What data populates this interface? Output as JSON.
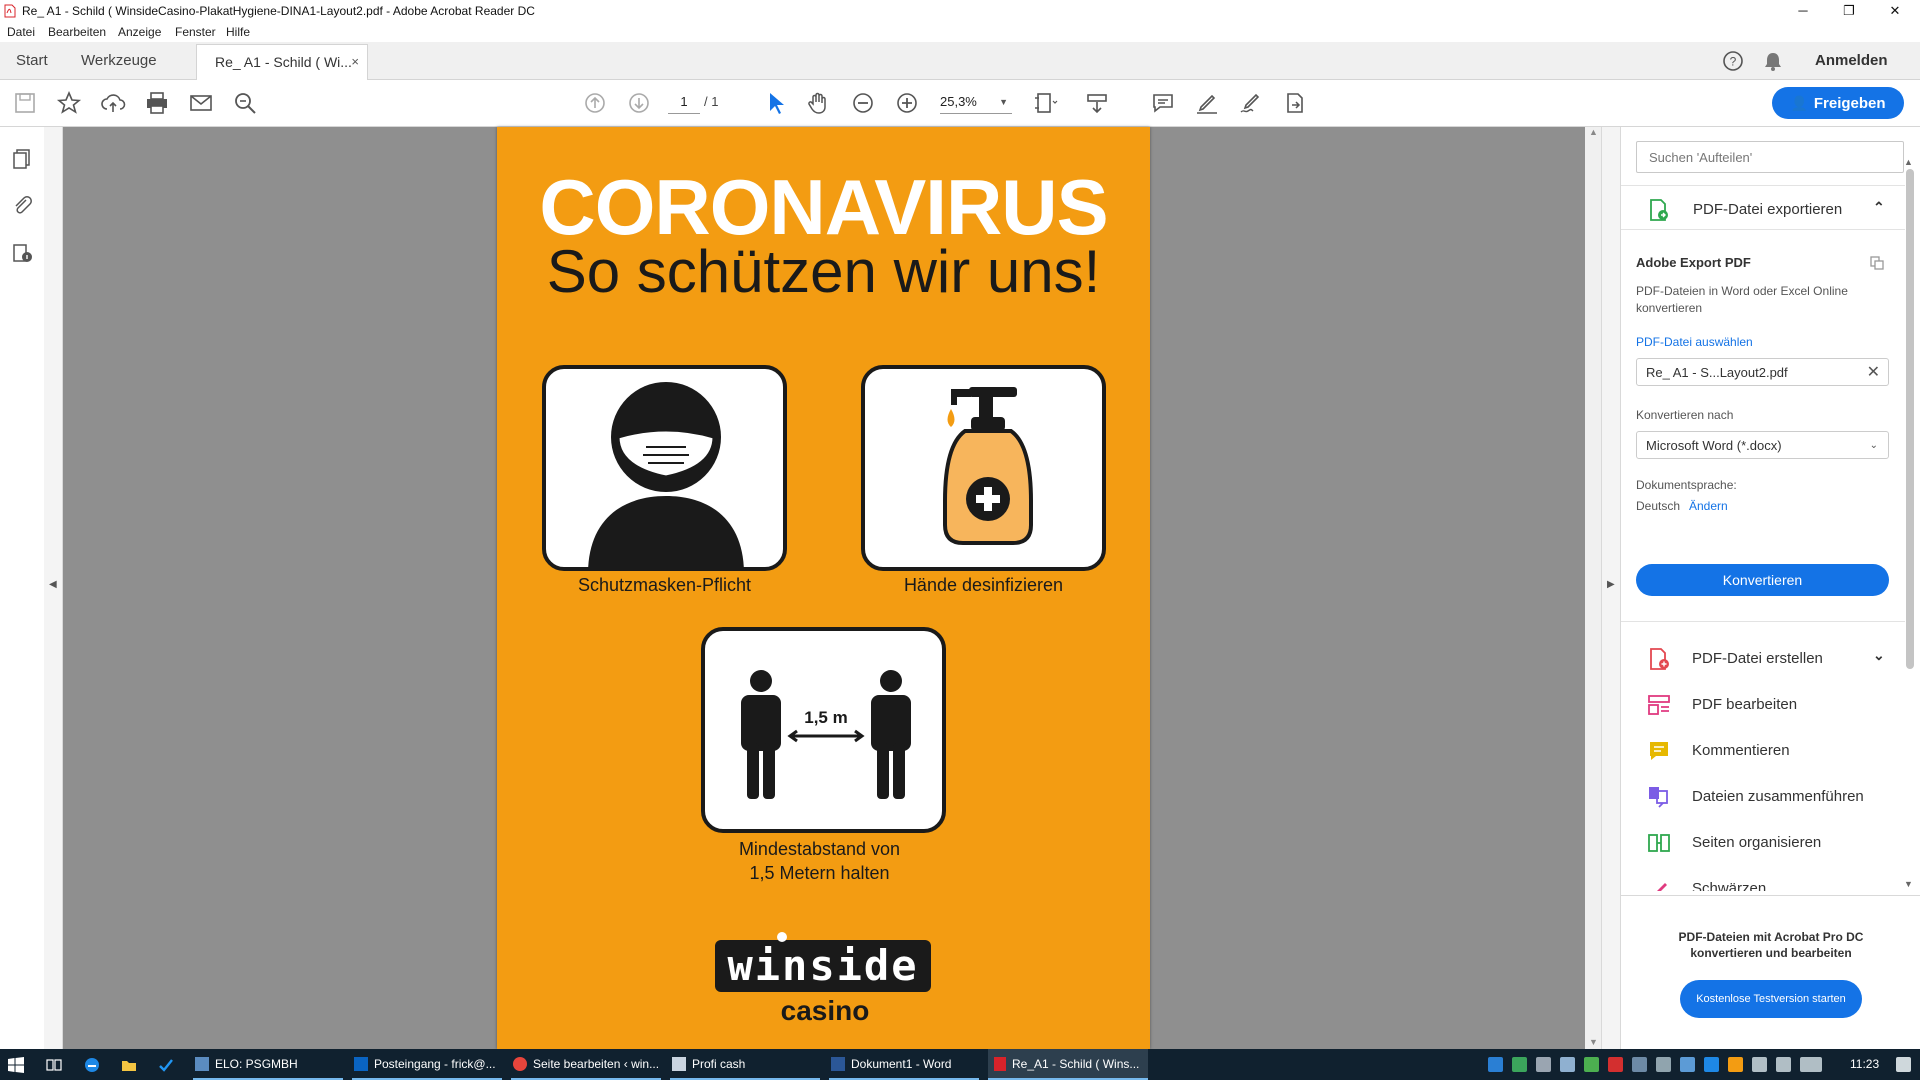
{
  "window": {
    "title": "Re_ A1 - Schild ( WinsideCasino-PlakatHygiene-DINA1-Layout2.pdf - Adobe Acrobat Reader DC",
    "controls": [
      "─",
      "❐",
      "✕"
    ]
  },
  "menu": [
    "Datei",
    "Bearbeiten",
    "Anzeige",
    "Fenster",
    "Hilfe"
  ],
  "tabs": {
    "start": "Start",
    "tools": "Werkzeuge",
    "document": "Re_ A1 - Schild ( Wi...",
    "close": "×",
    "signin": "Anmelden"
  },
  "toolbar": {
    "page_current": "1",
    "page_total": "/  1",
    "zoom": "25,3%",
    "share_label": "Freigeben",
    "icons": [
      "save-icon",
      "star-icon",
      "upload-icon",
      "print-icon",
      "mail-icon",
      "zoom-search-icon",
      "page-up-icon",
      "page-down-icon",
      "select-cursor-icon",
      "hand-icon",
      "zoom-out-icon",
      "zoom-in-icon",
      "fit-page-icon",
      "scroll-mode-icon",
      "comment-icon",
      "highlight-icon",
      "sign-icon",
      "share-doc-icon"
    ]
  },
  "poster": {
    "background": "#f39c12",
    "headline": "CORONAVIRUS",
    "subheadline": "So schützen wir uns!",
    "items": [
      {
        "label": "Schutzmasken-Pflicht"
      },
      {
        "label": "Hände desinfizieren"
      },
      {
        "label_line1": "Mindestabstand von",
        "label_line2": "1,5 Metern halten",
        "distance": "1,5 m"
      }
    ],
    "brand": "winside",
    "brand_sub": "casino"
  },
  "right_pane": {
    "search_placeholder": "Suchen 'Aufteilen'",
    "export": {
      "section_label": "PDF-Datei exportieren",
      "heading": "Adobe Export PDF",
      "description_line1": "PDF-Dateien in Word oder Excel Online",
      "description_line2": "konvertieren",
      "select_link": "PDF-Datei auswählen",
      "file": "Re_ A1 - S...Layout2.pdf",
      "convert_to_label": "Konvertieren nach",
      "format": "Microsoft Word (*.docx)",
      "language_label": "Dokumentsprache:",
      "language": "Deutsch",
      "change_link": "Ändern",
      "convert_button": "Konvertieren"
    },
    "tools": [
      {
        "label": "PDF-Datei erstellen",
        "icon": "create-pdf-icon",
        "color": "#e34850"
      },
      {
        "label": "PDF bearbeiten",
        "icon": "edit-pdf-icon",
        "color": "#e03a80"
      },
      {
        "label": "Kommentieren",
        "icon": "comment-tool-icon",
        "color": "#e6b800"
      },
      {
        "label": "Dateien zusammenführen",
        "icon": "combine-icon",
        "color": "#7b5ce5"
      },
      {
        "label": "Seiten organisieren",
        "icon": "organize-pages-icon",
        "color": "#2fa84f"
      },
      {
        "label": "Schwärzen",
        "icon": "redact-icon",
        "color": "#e03a80"
      }
    ],
    "promo_line1": "PDF-Dateien mit Acrobat Pro DC",
    "promo_line2": "konvertieren und bearbeiten",
    "promo_button": "Kostenlose Testversion starten"
  },
  "taskbar": {
    "items": [
      {
        "label": "ELO: PSGMBH",
        "icon": "elo-icon"
      },
      {
        "label": "Posteingang - frick@...",
        "icon": "outlook-icon"
      },
      {
        "label": "Seite bearbeiten ‹ win...",
        "icon": "chrome-icon"
      },
      {
        "label": "Profi cash",
        "icon": "profi-cash-icon"
      },
      {
        "label": "Dokument1 - Word",
        "icon": "word-icon"
      },
      {
        "label": "Re_A1 - Schild ( Wins...",
        "icon": "acrobat-icon"
      }
    ],
    "clock": "11:23"
  },
  "colors": {
    "accent": "#1473e6",
    "taskbar": "#10212f",
    "poster_orange": "#f39c12"
  }
}
